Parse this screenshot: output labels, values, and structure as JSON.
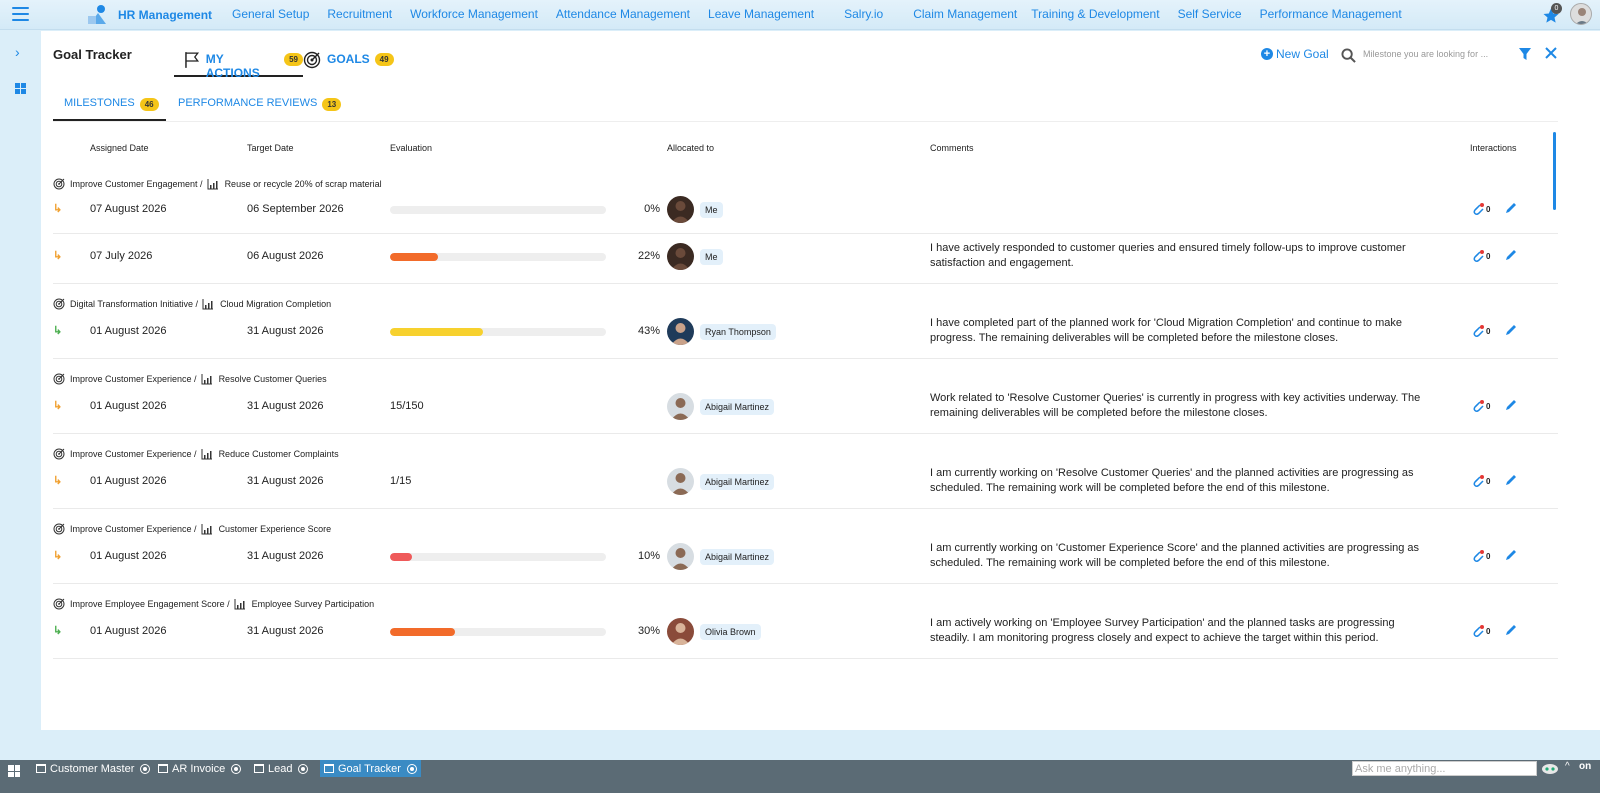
{
  "topbar": {
    "app_title": "HR Management",
    "nav": [
      "General Setup",
      "Recruitment",
      "Workforce Management",
      "Attendance Management",
      "Leave Management",
      "Salry.io",
      "Claim Management",
      "Training & Development",
      "Self Service",
      "Performance Management"
    ],
    "notification_count": "0"
  },
  "page": {
    "title": "Goal Tracker",
    "tabs": [
      {
        "label": "MY ACTIONS",
        "count": "59"
      },
      {
        "label": "GOALS",
        "count": "49"
      }
    ],
    "new_goal_label": "New Goal",
    "search_placeholder": "Milestone you are looking for ...",
    "subtabs": [
      {
        "label": "MILESTONES",
        "count": "46"
      },
      {
        "label": "PERFORMANCE REVIEWS",
        "count": "13"
      }
    ]
  },
  "table": {
    "headers": {
      "assigned": "Assigned Date",
      "target": "Target Date",
      "evaluation": "Evaluation",
      "allocated": "Allocated to",
      "comments": "Comments",
      "interactions": "Interactions"
    },
    "groups": [
      {
        "goal": "Improve Customer Engagement /",
        "milestone": "Reuse or recycle 20% of scrap material"
      },
      {
        "goal": "Digital Transformation Initiative /",
        "milestone": "Cloud Migration Completion"
      },
      {
        "goal": "Improve Customer Experience /",
        "milestone": "Resolve Customer Queries"
      },
      {
        "goal": "Improve Customer Experience /",
        "milestone": "Reduce Customer Complaints"
      },
      {
        "goal": "Improve Customer Experience /",
        "milestone": "Customer Experience Score"
      },
      {
        "goal": "Improve Employee Engagement Score /",
        "milestone": "Employee Survey Participation"
      }
    ],
    "rows": [
      {
        "arrow": "↳",
        "assigned": "07 August 2026",
        "target": "06 September 2026",
        "progress": 0,
        "eval": "0%",
        "person": "Me",
        "comment": "",
        "attachments": "0"
      },
      {
        "arrow": "↳",
        "assigned": "07 July 2026",
        "target": "06 August 2026",
        "progress": 22,
        "eval": "22%",
        "person": "Me",
        "comment": "I have actively responded to customer queries and ensured timely follow-ups to improve customer satisfaction and engagement.",
        "attachments": "0"
      },
      {
        "arrow": "↳",
        "assigned": "01 August 2026",
        "target": "31 August 2026",
        "progress": 43,
        "eval": "43%",
        "person": "Ryan Thompson",
        "comment": "I have completed part of the planned work for 'Cloud Migration Completion' and continue to make progress. The remaining deliverables will be completed before the milestone closes.",
        "attachments": "0"
      },
      {
        "arrow": "↳",
        "assigned": "01 August 2026",
        "target": "31 August 2026",
        "progress": null,
        "eval": "15/150",
        "person": "Abigail Martinez",
        "comment": "Work related to 'Resolve Customer Queries' is currently in progress with key activities underway. The remaining deliverables will be completed before the milestone closes.",
        "attachments": "0"
      },
      {
        "arrow": "↳",
        "assigned": "01 August 2026",
        "target": "31 August 2026",
        "progress": null,
        "eval": "1/15",
        "person": "Abigail Martinez",
        "comment": "I am currently working on 'Resolve Customer Queries' and the planned activities are progressing as scheduled. The remaining work will be completed before the end of this milestone.",
        "attachments": "0"
      },
      {
        "arrow": "↳",
        "assigned": "01 August 2026",
        "target": "31 August 2026",
        "progress": 10,
        "eval": "10%",
        "person": "Abigail Martinez",
        "comment": "I am currently working on 'Customer Experience Score' and the planned activities are progressing as scheduled. The remaining work will be completed before the end of this milestone.",
        "attachments": "0"
      },
      {
        "arrow": "↳",
        "assigned": "01 August 2026",
        "target": "31 August 2026",
        "progress": 30,
        "eval": "30%",
        "person": "Olivia Brown",
        "comment": "I am actively working on 'Employee Survey Participation' and the planned tasks are progressing steadily. I am monitoring progress closely and expect to achieve the target within this period.",
        "attachments": "0"
      }
    ]
  },
  "colors": {
    "accent": "#1e88e5",
    "badge": "#f5c518",
    "arrow_orange": "#f0a030",
    "arrow_green": "#4caf50",
    "progress_orange": "#f26b2a",
    "progress_yellow": "#f7d12e",
    "progress_red": "#ef5a5a"
  },
  "taskbar": {
    "tasks": [
      "Customer Master",
      "AR Invoice",
      "Lead",
      "Goal Tracker"
    ],
    "ask_placeholder": "Ask me anything..."
  }
}
